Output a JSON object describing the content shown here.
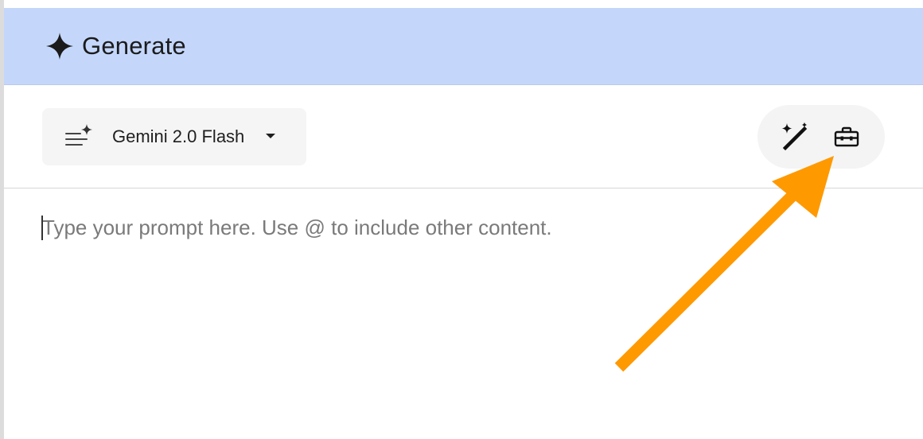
{
  "header": {
    "title": "Generate",
    "icon": "sparkle-icon",
    "background": "#c4d7fb"
  },
  "toolbar": {
    "model_selector": {
      "label": "Gemini 2.0 Flash",
      "icon": "model-sparkle-list-icon",
      "dropdown_icon": "caret-down-icon"
    },
    "actions": [
      {
        "name": "magic-wand-icon"
      },
      {
        "name": "toolbox-icon"
      }
    ]
  },
  "prompt": {
    "placeholder": "Type your prompt here. Use @ to include other content.",
    "value": ""
  },
  "annotation": {
    "type": "arrow",
    "color": "#ff9900",
    "points_to": "toolbox-button"
  }
}
